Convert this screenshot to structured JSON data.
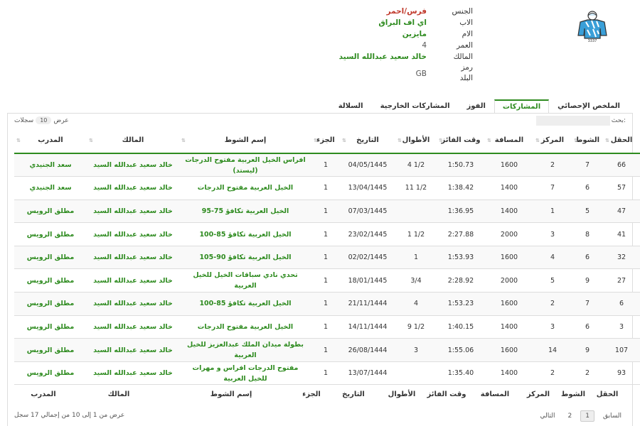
{
  "profile": {
    "rows": [
      {
        "label": "الجنس",
        "value": "فرس/احمر",
        "tone": "red"
      },
      {
        "label": "الاب",
        "value": "اي اف البراق",
        "tone": "green"
      },
      {
        "label": "الام",
        "value": "مايزين",
        "tone": "green"
      },
      {
        "label": "العمر",
        "value": "4",
        "tone": "gray"
      },
      {
        "label": "المالك",
        "value": "خالد سعيد عبدالله السيد",
        "tone": "green"
      },
      {
        "label": "رمز البلد",
        "value": "GB",
        "tone": "gray"
      }
    ]
  },
  "tabs": [
    {
      "label": "الملخص الإحصائي",
      "active": false
    },
    {
      "label": "المشاركات",
      "active": true
    },
    {
      "label": "الفوز",
      "active": false
    },
    {
      "label": "المشاركات الخارجية",
      "active": false
    },
    {
      "label": "السلالة",
      "active": false
    }
  ],
  "search": {
    "label": "بحث:"
  },
  "length": {
    "prefix": "عرض",
    "value": "10",
    "suffix": "سجلات"
  },
  "columns": [
    "الحقل",
    "الشوط",
    "المركز",
    "المسافة",
    "وقت الفائز",
    "الأطوال",
    "التاريخ",
    "الجزء",
    "إسم الشوط",
    "المالك",
    "المدرب"
  ],
  "rows": [
    {
      "field": "66",
      "race_no": "7",
      "place": "2",
      "distance": "1600",
      "time": "1:50.73",
      "lengths": "4 1/2",
      "date": "04/05/1445",
      "part": "1",
      "race": "افراس الخيل العربية مفتوح الدرجات (ليستد)",
      "owner": "خالد سعيد عبدالله السيد",
      "trainer": "سعد الجنيدي"
    },
    {
      "field": "57",
      "race_no": "6",
      "place": "7",
      "distance": "1400",
      "time": "1:38.42",
      "lengths": "11 1/2",
      "date": "13/04/1445",
      "part": "1",
      "race": "الخيل العربية مفتوح الدرجات",
      "owner": "خالد سعيد عبدالله السيد",
      "trainer": "سعد الجنيدي"
    },
    {
      "field": "47",
      "race_no": "5",
      "place": "1",
      "distance": "1400",
      "time": "1:36.95",
      "lengths": "",
      "date": "07/03/1445",
      "part": "1",
      "race": "الخيل العربية تكافؤ 75-95",
      "owner": "خالد سعيد عبدالله السيد",
      "trainer": "مطلق الرويس"
    },
    {
      "field": "41",
      "race_no": "8",
      "place": "3",
      "distance": "2000",
      "time": "2:27.88",
      "lengths": "1 1/2",
      "date": "23/02/1445",
      "part": "1",
      "race": "الخيل العربية تكافؤ 85-100",
      "owner": "خالد سعيد عبدالله السيد",
      "trainer": "مطلق الرويس"
    },
    {
      "field": "32",
      "race_no": "6",
      "place": "4",
      "distance": "1600",
      "time": "1:53.93",
      "lengths": "1",
      "date": "02/02/1445",
      "part": "1",
      "race": "الخيل العربية تكافؤ 90-105",
      "owner": "خالد سعيد عبدالله السيد",
      "trainer": "مطلق الرويس"
    },
    {
      "field": "27",
      "race_no": "9",
      "place": "5",
      "distance": "2000",
      "time": "2:28.92",
      "lengths": "3/4",
      "date": "18/01/1445",
      "part": "1",
      "race": "تحدي نادي سباقات الخيل للخيل العربية",
      "owner": "خالد سعيد عبدالله السيد",
      "trainer": "مطلق الرويس"
    },
    {
      "field": "6",
      "race_no": "7",
      "place": "2",
      "distance": "1600",
      "time": "1:53.23",
      "lengths": "4",
      "date": "21/11/1444",
      "part": "1",
      "race": "الخيل العربية تكافؤ 85-100",
      "owner": "خالد سعيد عبدالله السيد",
      "trainer": "مطلق الرويس"
    },
    {
      "field": "3",
      "race_no": "6",
      "place": "3",
      "distance": "1400",
      "time": "1:40.15",
      "lengths": "9 1/2",
      "date": "14/11/1444",
      "part": "1",
      "race": "الخيل العربية مفتوح الدرجات",
      "owner": "خالد سعيد عبدالله السيد",
      "trainer": "مطلق الرويس"
    },
    {
      "field": "107",
      "race_no": "9",
      "place": "14",
      "distance": "1600",
      "time": "1:55.06",
      "lengths": "3",
      "date": "26/08/1444",
      "part": "1",
      "race": "بطولة ميدان الملك عبدالعزيز للخيل العربية",
      "owner": "خالد سعيد عبدالله السيد",
      "trainer": "مطلق الرويس"
    },
    {
      "field": "93",
      "race_no": "2",
      "place": "2",
      "distance": "1400",
      "time": "1:35.40",
      "lengths": "",
      "date": "13/07/1444",
      "part": "1",
      "race": "مفتوح الدرجات افراس و مهرات للخيل العربية",
      "owner": "خالد سعيد عبدالله السيد",
      "trainer": "مطلق الرويس"
    }
  ],
  "pagination": {
    "prev": "السابق",
    "page1": "1",
    "page2": "2",
    "next": "التالي"
  },
  "summary": "عرض من 1 إلى 10 من إجمالي 17 سجل",
  "colors": {
    "accent": "#2e8b1f",
    "red": "#c0392b"
  }
}
